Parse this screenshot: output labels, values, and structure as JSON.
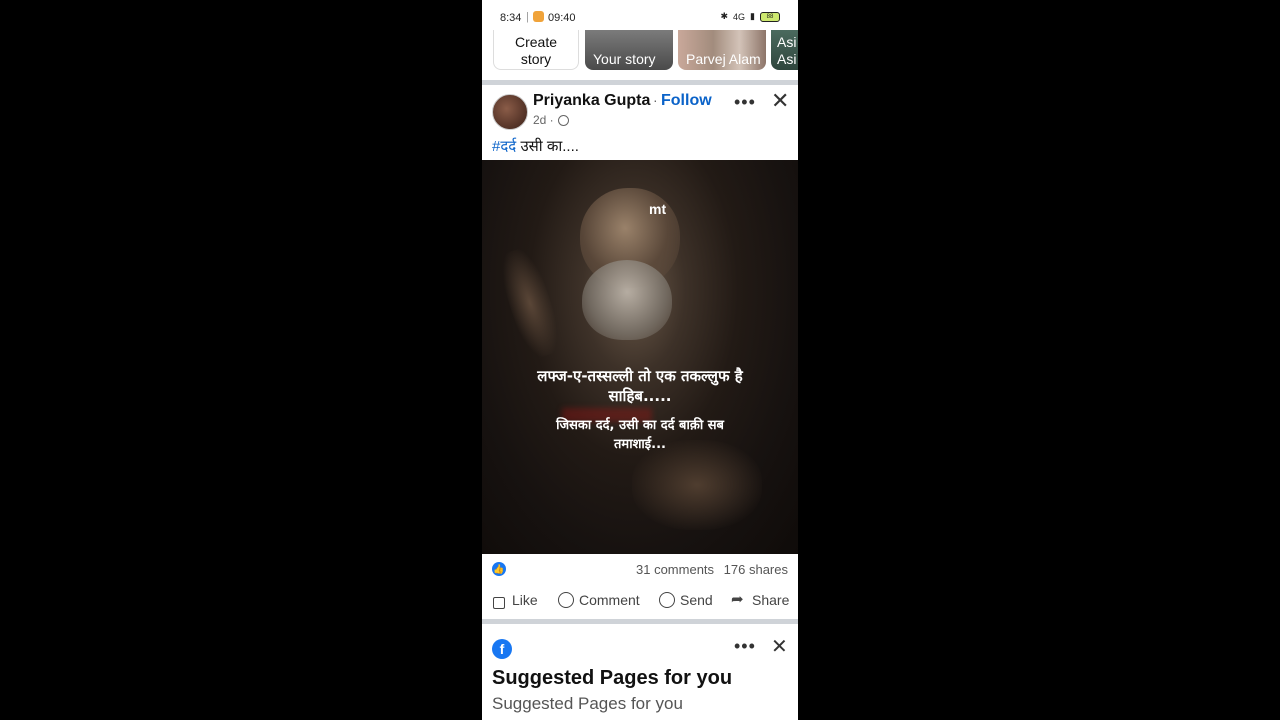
{
  "status_bar": {
    "time": "8:34",
    "call_time": "09:40",
    "battery": "88",
    "network": "4G"
  },
  "stories": [
    {
      "label": "Create story"
    },
    {
      "label": "Your story"
    },
    {
      "label": "Parvej Alam"
    },
    {
      "label": "Asi Asi"
    }
  ],
  "post": {
    "author": "Priyanka Gupta",
    "separator": "·",
    "follow_label": "Follow",
    "time": "2d ·",
    "caption_tag": "#दर्द",
    "caption_text": " उसी का....",
    "image": {
      "watermark": "mt",
      "line1": "लफ्ज-ए-तस्सल्ली तो एक तकल्लुफ है साहिब.....",
      "line2": "जिसका दर्द, उसी का दर्द बाक़ी सब तमाशाई..."
    },
    "comments": "31 comments",
    "shares": "176 shares",
    "actions": {
      "like": "Like",
      "comment": "Comment",
      "send": "Send",
      "share": "Share"
    }
  },
  "suggested": {
    "title": "Suggested Pages for you",
    "subtitle": "Suggested Pages for you"
  },
  "colors": {
    "accent": "#0b63c9",
    "facebook_blue": "#1877f2"
  }
}
